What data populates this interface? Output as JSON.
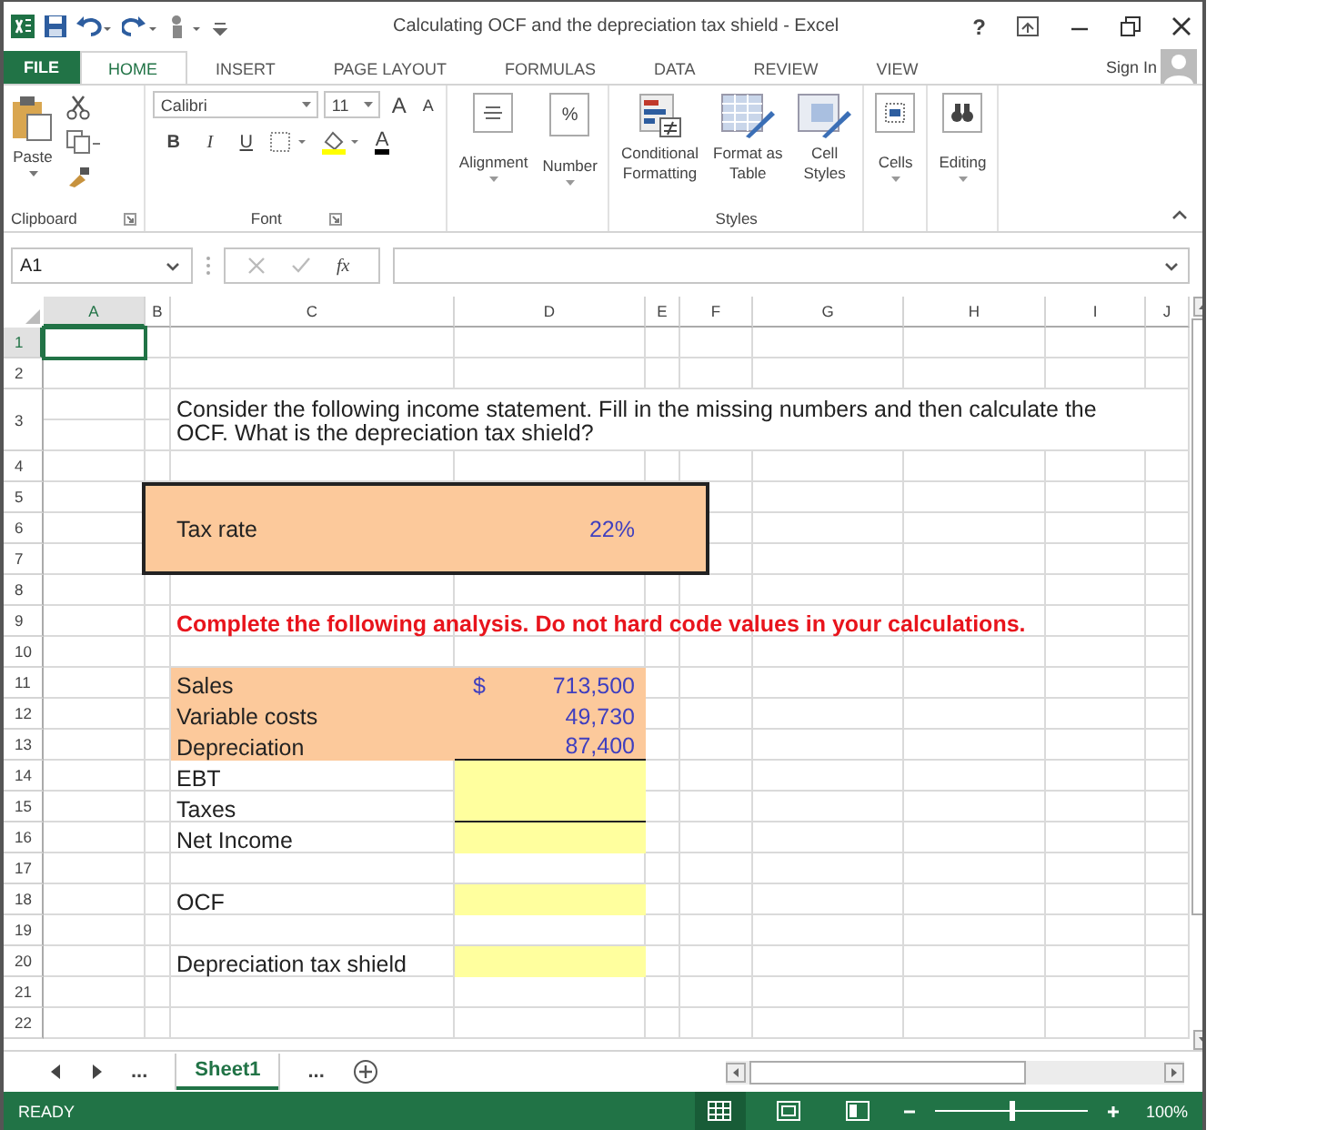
{
  "window": {
    "title": "Calculating OCF and the depreciation tax shield - Excel",
    "help": "?"
  },
  "tabs": [
    {
      "label": "FILE",
      "kind": "file",
      "selected": false
    },
    {
      "label": "HOME",
      "kind": "tab",
      "selected": true
    },
    {
      "label": "INSERT",
      "kind": "tab",
      "selected": false
    },
    {
      "label": "PAGE LAYOUT",
      "kind": "tab",
      "selected": false
    },
    {
      "label": "FORMULAS",
      "kind": "tab",
      "selected": false
    },
    {
      "label": "DATA",
      "kind": "tab",
      "selected": false
    },
    {
      "label": "REVIEW",
      "kind": "tab",
      "selected": false
    },
    {
      "label": "VIEW",
      "kind": "tab",
      "selected": false
    }
  ],
  "sign_in": "Sign In",
  "ribbon": {
    "clipboard": {
      "label": "Clipboard",
      "paste": "Paste"
    },
    "font": {
      "label": "Font",
      "name": "Calibri",
      "size": "11",
      "grow": "A",
      "shrink": "A",
      "bold": "B",
      "italic": "I",
      "underline": "U",
      "font_color": "A"
    },
    "alignment": "Alignment",
    "number": {
      "label": "Number",
      "symbol": "%"
    },
    "styles": {
      "label": "Styles",
      "buttons": [
        {
          "lines": [
            "Conditional",
            "Formatting"
          ],
          "kind": "conditional"
        },
        {
          "lines": [
            "Format as",
            "Table"
          ],
          "kind": "table"
        },
        {
          "lines": [
            "Cell",
            "Styles"
          ],
          "kind": "cellstyles"
        }
      ]
    },
    "cells": "Cells",
    "editing": "Editing"
  },
  "formula_bar": {
    "name_box": "A1",
    "function_label": "fx"
  },
  "sheet": {
    "columns": [
      {
        "label": "A",
        "selected": true
      },
      {
        "label": "B",
        "selected": false
      },
      {
        "label": "C",
        "selected": false
      },
      {
        "label": "D",
        "selected": false
      },
      {
        "label": "E",
        "selected": false
      },
      {
        "label": "F",
        "selected": false
      },
      {
        "label": "G",
        "selected": false
      },
      {
        "label": "H",
        "selected": false
      },
      {
        "label": "I",
        "selected": false
      },
      {
        "label": "J",
        "selected": false
      }
    ],
    "rows": [
      {
        "label": "1",
        "selected": true
      },
      {
        "label": "2",
        "selected": false
      },
      {
        "label": "3",
        "selected": false,
        "cells": [
          {
            "kind": "question",
            "text": "Consider the following income statement. Fill in the missing numbers and then calculate the OCF. What is the depreciation tax shield?"
          }
        ]
      },
      {
        "label": "4",
        "selected": false
      },
      {
        "label": "5",
        "selected": false,
        "cells": [
          {
            "kind": "box"
          }
        ]
      },
      {
        "label": "6",
        "selected": false,
        "cells": [
          {
            "kind": "box_label",
            "text": "Tax rate"
          },
          {
            "kind": "box_value",
            "text": "22%"
          }
        ]
      },
      {
        "label": "7",
        "selected": false
      },
      {
        "label": "8",
        "selected": false
      },
      {
        "label": "9",
        "selected": false,
        "cells": [
          {
            "kind": "note",
            "text": "Complete the following analysis. Do not hard code values in your calculations."
          }
        ]
      },
      {
        "label": "10",
        "selected": false
      },
      {
        "label": "11",
        "selected": false,
        "cells": [
          {
            "kind": "input_label",
            "text": "Sales"
          },
          {
            "kind": "input_value",
            "currency": "$",
            "text": "713,500"
          }
        ]
      },
      {
        "label": "12",
        "selected": false,
        "cells": [
          {
            "kind": "input_label",
            "text": "Variable costs"
          },
          {
            "kind": "input_value",
            "text": "49,730"
          }
        ]
      },
      {
        "label": "13",
        "selected": false,
        "cells": [
          {
            "kind": "input_label",
            "text": "Depreciation"
          },
          {
            "kind": "input_value",
            "text": "87,400",
            "underlined": true
          }
        ]
      },
      {
        "label": "14",
        "selected": false,
        "cells": [
          {
            "kind": "label",
            "text": "EBT"
          },
          {
            "kind": "answer"
          }
        ]
      },
      {
        "label": "15",
        "selected": false,
        "cells": [
          {
            "kind": "label",
            "text": "Taxes"
          },
          {
            "kind": "answer",
            "underlined": true
          }
        ]
      },
      {
        "label": "16",
        "selected": false,
        "cells": [
          {
            "kind": "label",
            "text": "Net Income"
          },
          {
            "kind": "answer"
          }
        ]
      },
      {
        "label": "17",
        "selected": false
      },
      {
        "label": "18",
        "selected": false,
        "cells": [
          {
            "kind": "label",
            "text": "OCF"
          },
          {
            "kind": "answer"
          }
        ]
      },
      {
        "label": "19",
        "selected": false
      },
      {
        "label": "20",
        "selected": false,
        "cells": [
          {
            "kind": "label",
            "text": "Depreciation tax shield"
          },
          {
            "kind": "answer"
          }
        ]
      },
      {
        "label": "21",
        "selected": false
      },
      {
        "label": "22",
        "selected": false
      }
    ]
  },
  "sheet_tabs": [
    {
      "label": "...",
      "kind": "more"
    },
    {
      "label": "Sheet1",
      "kind": "sheet",
      "selected": true
    },
    {
      "label": "...",
      "kind": "more"
    }
  ],
  "status_bar": {
    "mode": "READY",
    "views": [
      {
        "kind": "normal",
        "selected": true
      },
      {
        "kind": "page_layout",
        "selected": false
      },
      {
        "kind": "page_break",
        "selected": false
      }
    ],
    "zoom": {
      "level": 0.5,
      "reading": "100%"
    }
  }
}
